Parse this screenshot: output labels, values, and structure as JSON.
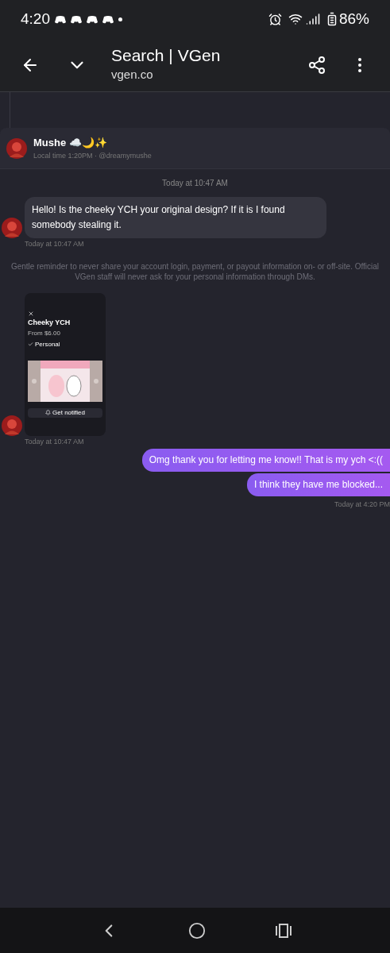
{
  "status_bar": {
    "time": "4:20",
    "battery": "86%"
  },
  "toolbar": {
    "title": "Search | VGen",
    "url": "vgen.co"
  },
  "chat_header": {
    "name": "Mushe",
    "emoji": "☁️🌙✨",
    "subtitle": "Local time 1:20PM · @dreamymushe"
  },
  "messages": [
    {
      "kind": "divider",
      "text": "Today at 10:47 AM"
    },
    {
      "kind": "incoming",
      "text": "Hello! Is the cheeky YCH your original design? If it is I found somebody stealing it.",
      "time": "Today at 10:47 AM"
    },
    {
      "kind": "notice",
      "text": "Gentle reminder to never share your account login, payment, or payout information on- or off-site. Official VGen staff will never ask for your personal information through DMs."
    },
    {
      "time": "Today at 10:47 AM",
      "shot": {
        "title": "Cheeky YCH",
        "price": "From $6.00",
        "option": "Personal",
        "button": "Get notified"
      }
    },
    {
      "kind": "outgoing",
      "text": "Omg thank you for letting me know!! That is my ych <:(("
    },
    {
      "kind": "outgoing",
      "text": "I think they have me blocked...",
      "time": "Today at 4:20 PM"
    }
  ]
}
